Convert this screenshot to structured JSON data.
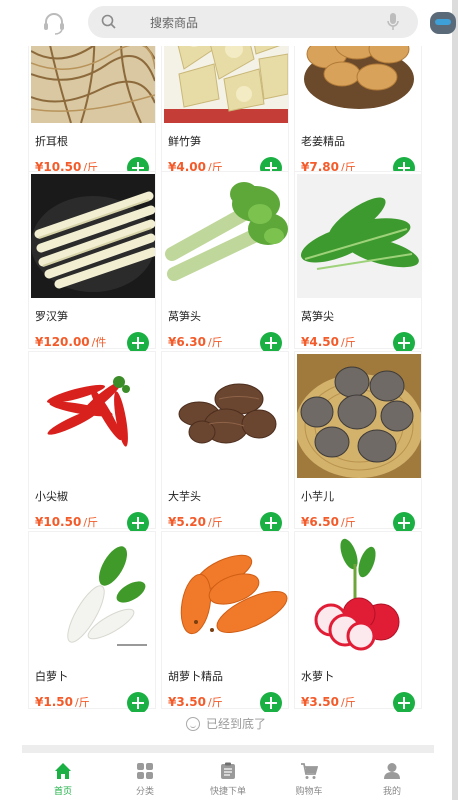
{
  "header": {
    "search_placeholder": "搜索商品",
    "icons": [
      "headset-icon",
      "search-icon",
      "microphone-icon",
      "message-icon"
    ]
  },
  "products": [
    {
      "name": "折耳根",
      "price": "¥10.50",
      "unit": "/斤",
      "image": "dried-root-strands"
    },
    {
      "name": "鲜竹笋",
      "price": "¥4.00",
      "unit": "/斤",
      "image": "sliced-bamboo-shoots"
    },
    {
      "name": "老姜精品",
      "price": "¥7.80",
      "unit": "/斤",
      "image": "ginger-root"
    },
    {
      "name": "罗汉笋",
      "price": "¥120.00",
      "unit": "/件",
      "image": "bamboo-shoot-sticks"
    },
    {
      "name": "莴笋头",
      "price": "¥6.30",
      "unit": "/斤",
      "image": "celtuce-stems"
    },
    {
      "name": "莴笋尖",
      "price": "¥4.50",
      "unit": "/斤",
      "image": "lettuce-leaves"
    },
    {
      "name": "小尖椒",
      "price": "¥10.50",
      "unit": "/斤",
      "image": "red-chili-peppers"
    },
    {
      "name": "大芋头",
      "price": "¥5.20",
      "unit": "/斤",
      "image": "taro"
    },
    {
      "name": "小芋儿",
      "price": "¥6.50",
      "unit": "/斤",
      "image": "small-taro-basket"
    },
    {
      "name": "白萝卜",
      "price": "¥1.50",
      "unit": "/斤",
      "image": "white-radish"
    },
    {
      "name": "胡萝卜精品",
      "price": "¥3.50",
      "unit": "/斤",
      "image": "carrots"
    },
    {
      "name": "水萝卜",
      "price": "¥3.50",
      "unit": "/斤",
      "image": "red-radish"
    }
  ],
  "end_note": "已经到底了",
  "tabbar": {
    "tabs": [
      {
        "label": "首页",
        "icon": "home-icon",
        "active": true
      },
      {
        "label": "分类",
        "icon": "category-grid-icon",
        "active": false
      },
      {
        "label": "快捷下单",
        "icon": "clipboard-icon",
        "active": false
      },
      {
        "label": "购物车",
        "icon": "cart-icon",
        "active": false
      },
      {
        "label": "我的",
        "icon": "user-icon",
        "active": false
      }
    ]
  },
  "colors": {
    "accent_green": "#1bb043",
    "price_orange": "#f35b2a"
  }
}
